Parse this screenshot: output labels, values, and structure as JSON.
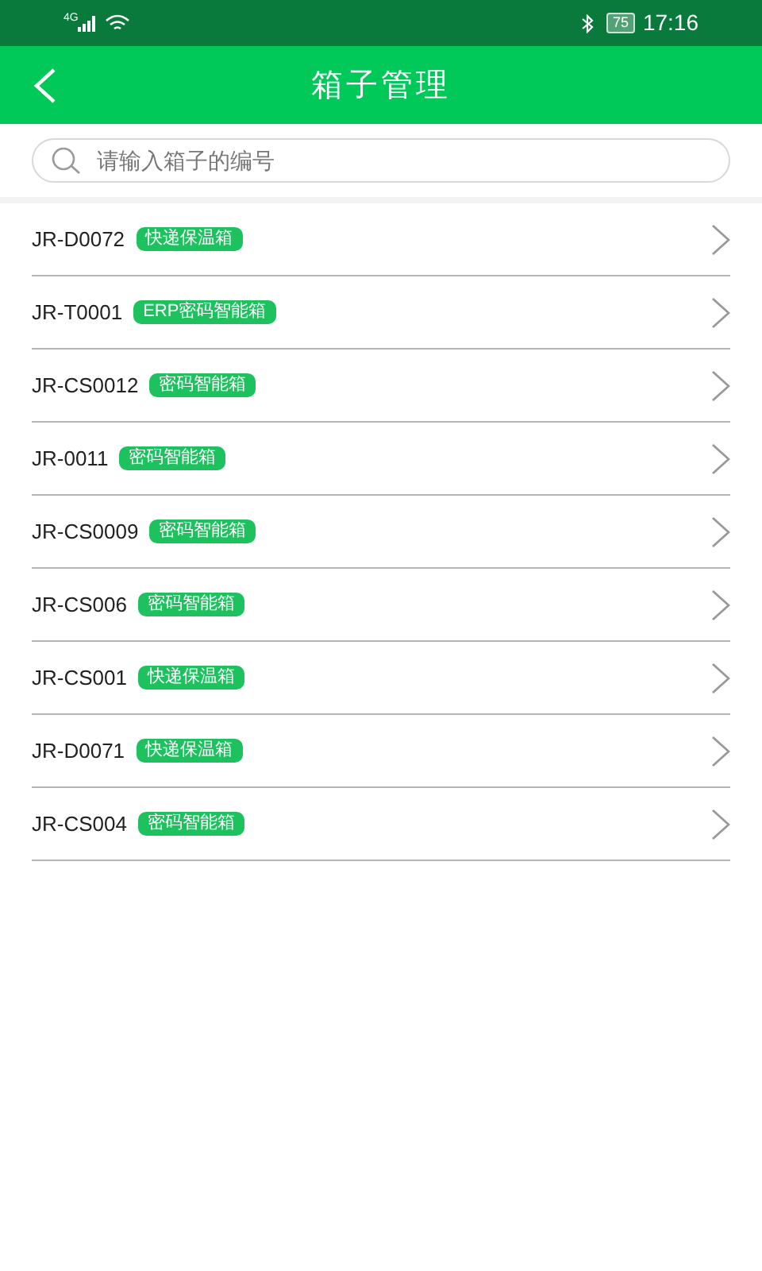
{
  "status_bar": {
    "network": "4G",
    "battery": "75",
    "time": "17:16"
  },
  "header": {
    "title": "箱子管理"
  },
  "search": {
    "placeholder": "请输入箱子的编号"
  },
  "boxes": [
    {
      "code": "JR-D0072",
      "tag": "快递保温箱"
    },
    {
      "code": "JR-T0001",
      "tag": "ERP密码智能箱"
    },
    {
      "code": "JR-CS0012",
      "tag": "密码智能箱"
    },
    {
      "code": "JR-0011",
      "tag": "密码智能箱"
    },
    {
      "code": "JR-CS0009",
      "tag": "密码智能箱"
    },
    {
      "code": "JR-CS006",
      "tag": "密码智能箱"
    },
    {
      "code": "JR-CS001",
      "tag": "快递保温箱"
    },
    {
      "code": "JR-D0071",
      "tag": "快递保温箱"
    },
    {
      "code": "JR-CS004",
      "tag": "密码智能箱"
    }
  ]
}
